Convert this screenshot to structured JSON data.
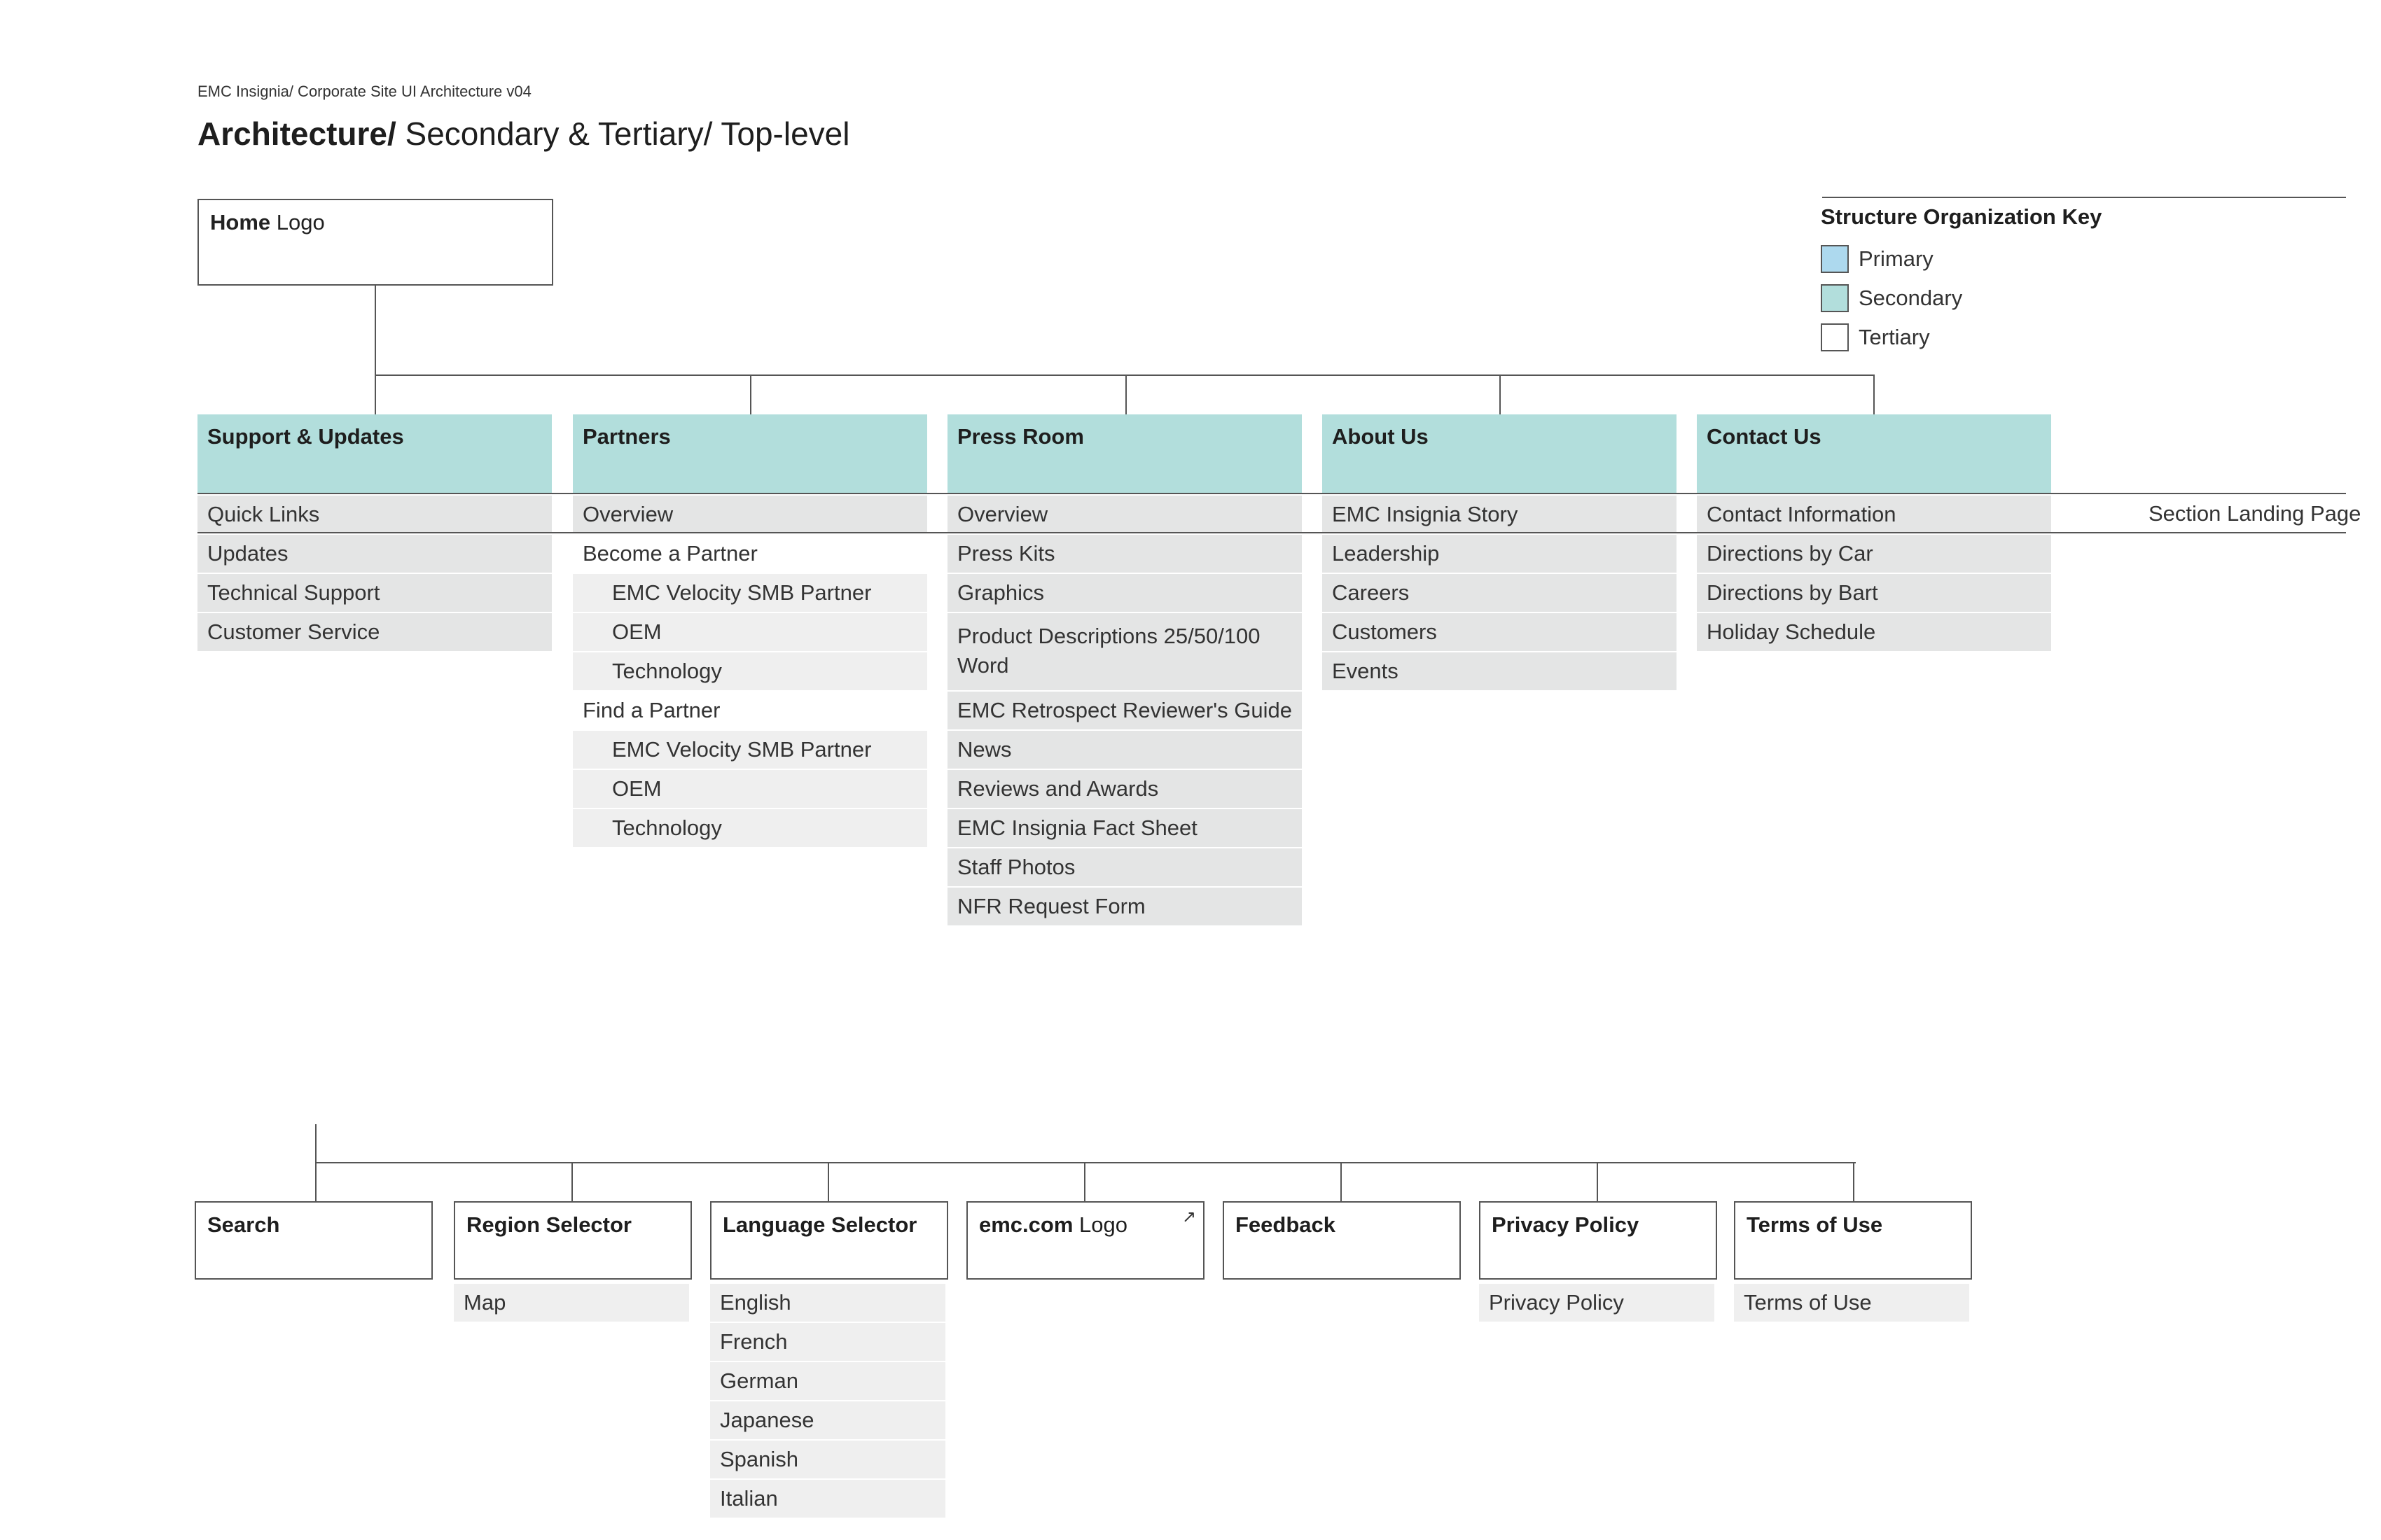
{
  "header": {
    "subtitle": "EMC Insignia/ Corporate Site UI Architecture v04",
    "title_bold": "Architecture/",
    "title_rest": " Secondary & Tertiary/ Top-level"
  },
  "home": {
    "label_bold": "Home",
    "label_rest": " Logo"
  },
  "key": {
    "title": "Structure Organization Key",
    "items": [
      {
        "label": "Primary",
        "color": "#add9ee"
      },
      {
        "label": "Secondary",
        "color": "#b2dedc"
      },
      {
        "label": "Tertiary",
        "color": "#ffffff"
      }
    ]
  },
  "landing_label": "Section Landing Page",
  "sections": [
    {
      "title": "Support & Updates",
      "items": [
        "Quick Links",
        "Updates",
        "Technical Support",
        "Customer Service"
      ]
    },
    {
      "title": "Partners",
      "items": [
        "Overview",
        "Become a Partner",
        "EMC Velocity SMB Partner",
        "OEM",
        "Technology",
        "Find a Partner",
        "EMC Velocity SMB Partner",
        "OEM",
        "Technology"
      ]
    },
    {
      "title": "Press Room",
      "items": [
        "Overview",
        "Press Kits",
        "Graphics",
        "Product Descriptions 25/50/100 Word",
        "EMC Retrospect Reviewer's Guide",
        "News",
        "Reviews and Awards",
        "EMC Insignia Fact Sheet",
        "Staff Photos",
        "NFR Request Form"
      ]
    },
    {
      "title": "About Us",
      "items": [
        "EMC Insignia Story",
        "Leadership",
        "Careers",
        "Customers",
        "Events"
      ]
    },
    {
      "title": "Contact Us",
      "items": [
        "Contact Information",
        "Directions by Car",
        "Directions by Bart",
        "Holiday Schedule"
      ]
    }
  ],
  "utility": [
    {
      "title": "Search",
      "items": []
    },
    {
      "title": "Region Selector",
      "items": [
        "Map"
      ]
    },
    {
      "title": "Language Selector",
      "items": [
        "English",
        "French",
        "German",
        "Japanese",
        "Spanish",
        "Italian"
      ]
    },
    {
      "title_bold": "emc.com",
      "title_rest": " Logo",
      "items": [],
      "icon": "external-link-icon",
      "icon_glyph": "↗"
    },
    {
      "title": "Feedback",
      "items": []
    },
    {
      "title": "Privacy Policy",
      "items": [
        "Privacy Policy"
      ]
    },
    {
      "title": "Terms of Use",
      "items": [
        "Terms of Use"
      ]
    }
  ]
}
